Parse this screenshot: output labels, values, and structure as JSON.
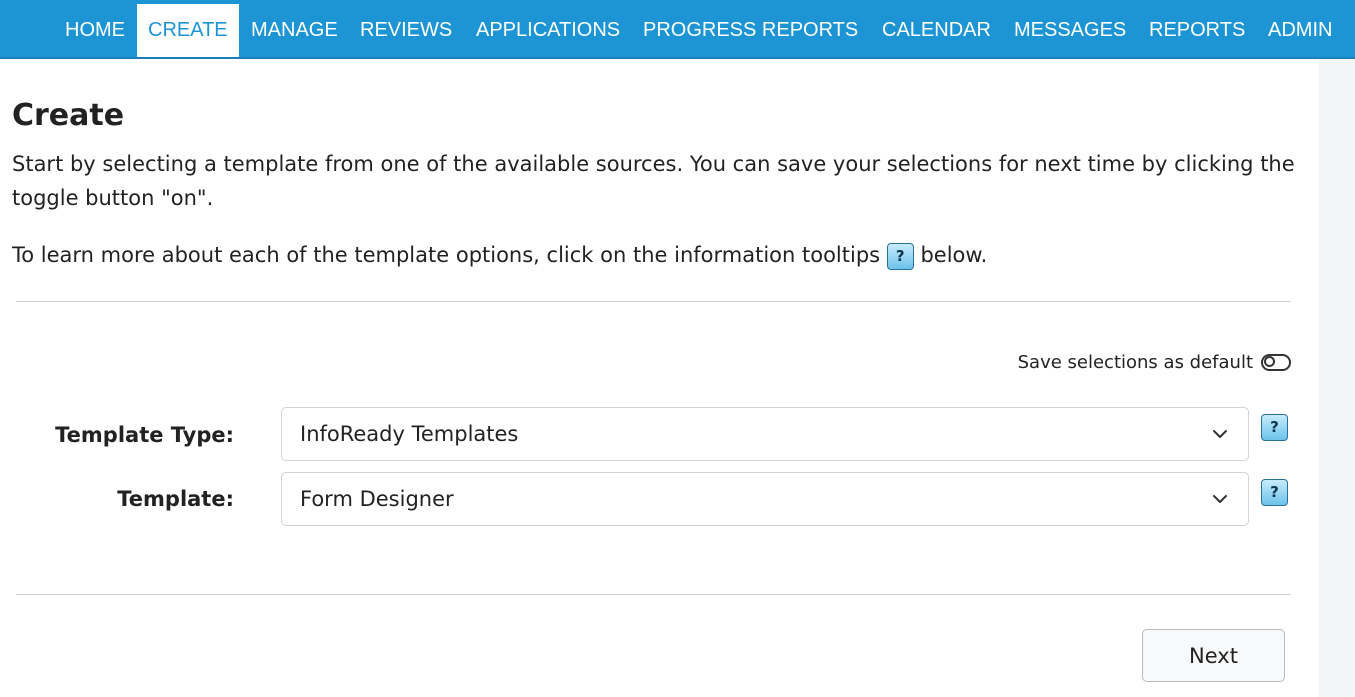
{
  "nav": {
    "items": [
      {
        "label": "HOME",
        "active": false
      },
      {
        "label": "CREATE",
        "active": true
      },
      {
        "label": "MANAGE",
        "active": false
      },
      {
        "label": "REVIEWS",
        "active": false
      },
      {
        "label": "APPLICATIONS",
        "active": false
      },
      {
        "label": "PROGRESS REPORTS",
        "active": false
      },
      {
        "label": "CALENDAR",
        "active": false
      },
      {
        "label": "MESSAGES",
        "active": false
      },
      {
        "label": "REPORTS",
        "active": false
      },
      {
        "label": "ADMIN",
        "active": false
      }
    ],
    "bar_color": "#1d95d4"
  },
  "page": {
    "title": "Create",
    "intro": "Start by selecting a template from one of the available sources. You can save your selections for next time by clicking the toggle button \"on\".",
    "tooltip_hint_before": "To learn more about each of the template options, click on the information tooltips",
    "tooltip_hint_after": "below.",
    "help_icon_glyph": "?"
  },
  "save_default": {
    "label": "Save selections as default",
    "enabled": false
  },
  "form": {
    "template_type_label": "Template Type:",
    "template_type_value": "InfoReady Templates",
    "template_label": "Template:",
    "template_value": "Form Designer"
  },
  "actions": {
    "next_label": "Next"
  },
  "icons": {
    "help": "question-mark-icon",
    "dropdown": "chevron-down-icon",
    "toggle": "toggle-off-icon"
  }
}
